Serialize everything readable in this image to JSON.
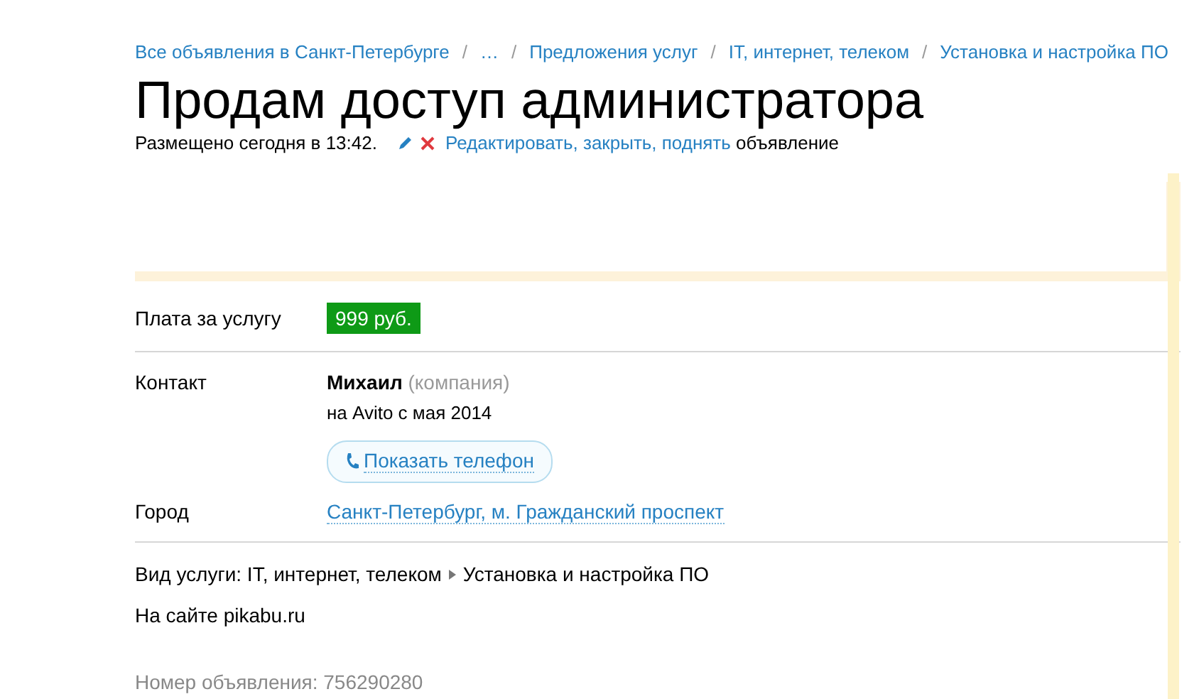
{
  "breadcrumbs": [
    {
      "kind": "link",
      "text": "Все объявления в Санкт-Петербурге"
    },
    {
      "kind": "separator",
      "text": "/"
    },
    {
      "kind": "link",
      "text": "…"
    },
    {
      "kind": "separator",
      "text": "/"
    },
    {
      "kind": "link",
      "text": "Предложения услуг"
    },
    {
      "kind": "separator",
      "text": "/"
    },
    {
      "kind": "link",
      "text": "IT, интернет, телеком"
    },
    {
      "kind": "separator",
      "text": "/"
    },
    {
      "kind": "link",
      "text": "Установка и настройка ПО"
    }
  ],
  "title": "Продам доступ администратора",
  "posted": "Размещено сегодня в 13:42.",
  "edit_link": "Редактировать, закрыть, поднять",
  "edit_suffix": " объявление",
  "price": {
    "label": "Плата за услугу",
    "value": "999 руб."
  },
  "contact": {
    "label": "Контакт",
    "name": "Михаил",
    "type": "(компания)",
    "since": "на Avito с мая 2014",
    "phone_button": "Показать телефон"
  },
  "city": {
    "label": "Город",
    "value": "Санкт-Петербург, м. Гражданский проспект"
  },
  "service": {
    "category": "Вид услуги: IT, интернет, телеком",
    "subcategory": "Установка и настройка ПО"
  },
  "description": "На сайте pikabu.ru",
  "ad_number": "Номер объявления: 756290280"
}
